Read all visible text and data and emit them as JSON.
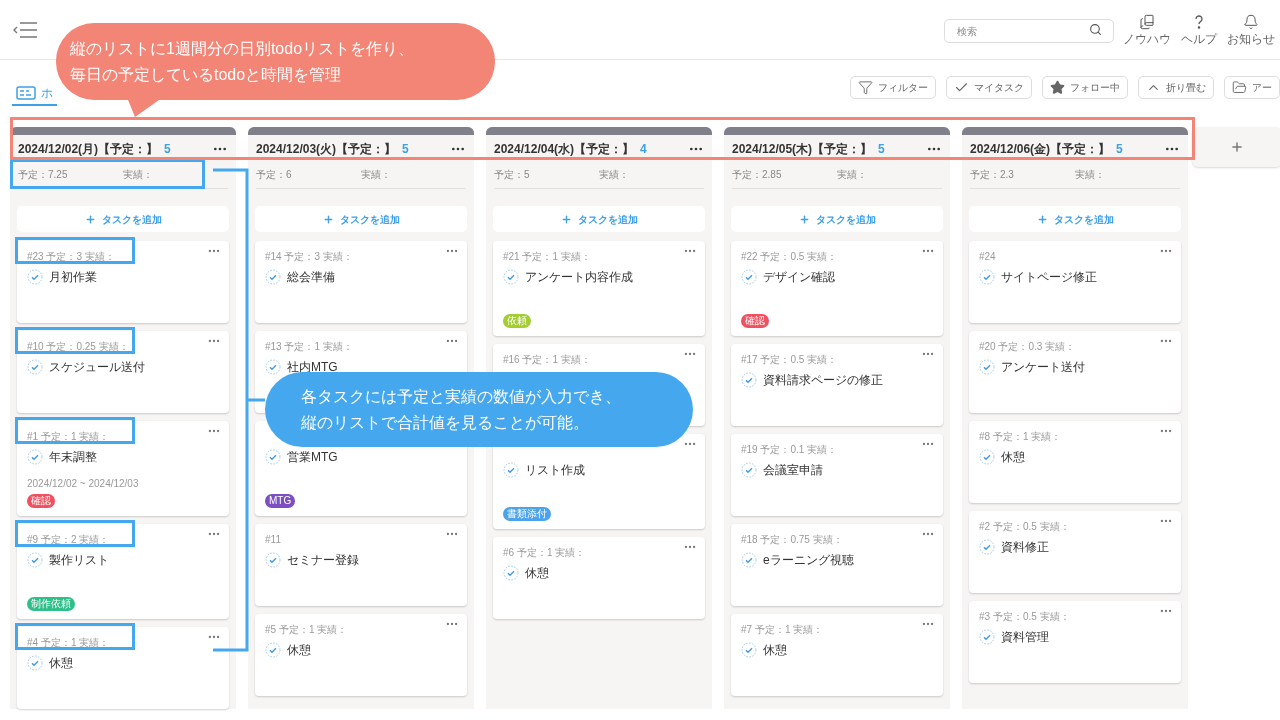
{
  "topbar": {
    "search": {
      "placeholder": "検索"
    },
    "nav": [
      {
        "kind": "book",
        "label": "ノウハウ"
      },
      {
        "kind": "help",
        "label": "ヘルプ"
      },
      {
        "kind": "bell",
        "label": "お知らせ"
      }
    ]
  },
  "tab": {
    "label": "ホ",
    "selected": true
  },
  "toolbar": [
    {
      "kind": "filter",
      "label": "フィルター"
    },
    {
      "kind": "check",
      "label": "マイタスク"
    },
    {
      "kind": "star",
      "label": "フォロー中"
    },
    {
      "kind": "collapse",
      "label": "折り畳む"
    },
    {
      "kind": "folder",
      "label": "アー"
    }
  ],
  "columns": [
    {
      "title": "2024/12/02(月)【予定：】",
      "count": "5",
      "planned": "予定：7.25",
      "actual": "実績：",
      "highlighted": true,
      "add_label": "タスクを追加",
      "cards": [
        {
          "meta": "#23 予定：3 実績：",
          "title": "月初作業",
          "highlighted": true
        },
        {
          "meta": "#10 予定：0.25 実績：",
          "title": "スケジュール送付",
          "highlighted": true
        },
        {
          "meta": "#1 予定：1 実績：",
          "title": "年末調整",
          "date": "2024/12/02 ~ 2024/12/03",
          "tag": {
            "label": "確認",
            "color": "#f0505f"
          },
          "highlighted": true
        },
        {
          "meta": "#9 予定：2 実績：",
          "title": "製作リスト",
          "tag": {
            "label": "制作依頼",
            "color": "#2fbf8a"
          },
          "highlighted": true
        },
        {
          "meta": "#4 予定：1 実績：",
          "title": "休憩",
          "highlighted": true
        }
      ]
    },
    {
      "title": "2024/12/03(火)【予定：】",
      "count": "5",
      "planned": "予定：6",
      "actual": "実績：",
      "highlighted": false,
      "add_label": "タスクを追加",
      "cards": [
        {
          "meta": "#14 予定：3 実績：",
          "title": "総会準備",
          "highlighted": false
        },
        {
          "meta": "#13 予定：1 実績：",
          "title": "社内MTG",
          "highlighted": false
        },
        {
          "title": "営業MTG",
          "tag": {
            "label": "MTG",
            "color": "#7b4fc0"
          },
          "highlighted": false,
          "menu_visible": false
        },
        {
          "meta": "#11",
          "title": "セミナー登録",
          "highlighted": false
        },
        {
          "meta": "#5 予定：1 実績：",
          "title": "休憩",
          "highlighted": false
        }
      ]
    },
    {
      "title": "2024/12/04(水)【予定：】",
      "count": "4",
      "planned": "予定：5",
      "actual": "実績：",
      "highlighted": false,
      "add_label": "タスクを追加",
      "cards": [
        {
          "meta": "#21 予定：1 実績：",
          "title": "アンケート内容作成",
          "tag": {
            "label": "依頼",
            "color": "#a3cc35"
          },
          "highlighted": false
        },
        {
          "meta": "#16 予定：1 実績：",
          "highlighted": false
        },
        {
          "title": "リスト作成",
          "tag": {
            "label": "書類添付",
            "color": "#4aa3ec"
          },
          "highlighted": false
        },
        {
          "meta": "#6 予定：1 実績：",
          "title": "休憩",
          "highlighted": false
        }
      ]
    },
    {
      "title": "2024/12/05(木)【予定：】",
      "count": "5",
      "planned": "予定：2.85",
      "actual": "実績：",
      "highlighted": false,
      "add_label": "タスクを追加",
      "cards": [
        {
          "meta": "#22 予定：0.5 実績：",
          "title": "デザイン確認",
          "tag": {
            "label": "確認",
            "color": "#f0505f"
          },
          "highlighted": false
        },
        {
          "meta": "#17 予定：0.5 実績：",
          "title": "資料請求ページの修正",
          "highlighted": false
        },
        {
          "meta": "#19 予定：0.1 実績：",
          "title": "会議室申請",
          "highlighted": false
        },
        {
          "meta": "#18 予定：0.75 実績：",
          "title": "eラーニング視聴",
          "highlighted": false
        },
        {
          "meta": "#7 予定：1 実績：",
          "title": "休憩",
          "highlighted": false
        }
      ]
    },
    {
      "title": "2024/12/06(金)【予定：】",
      "count": "5",
      "planned": "予定：2.3",
      "actual": "実績：",
      "highlighted": false,
      "add_label": "タスクを追加",
      "cards": [
        {
          "meta": "#24",
          "title": "サイトページ修正",
          "highlighted": false
        },
        {
          "meta": "#20 予定：0.3 実績：",
          "title": "アンケート送付",
          "highlighted": false
        },
        {
          "meta": "#8 予定：1 実績：",
          "title": "休憩",
          "highlighted": false
        },
        {
          "meta": "#2 予定：0.5 実績：",
          "title": "資料修正",
          "highlighted": false
        },
        {
          "meta": "#3 予定：0.5 実績：",
          "title": "資料管理",
          "highlighted": false
        }
      ]
    }
  ],
  "annotations": [
    {
      "kind": "header",
      "lines": [
        "縦のリストに1週間分の日別todoリストを作り、",
        "毎日の予定しているtodoと時間を管理"
      ],
      "color": "#f28576"
    },
    {
      "kind": "list",
      "lines": [
        "各タスクには予定と実績の数値が入力でき、",
        "縦のリストで合計値を見ることが可能。"
      ],
      "color": "#45a8ee"
    }
  ]
}
